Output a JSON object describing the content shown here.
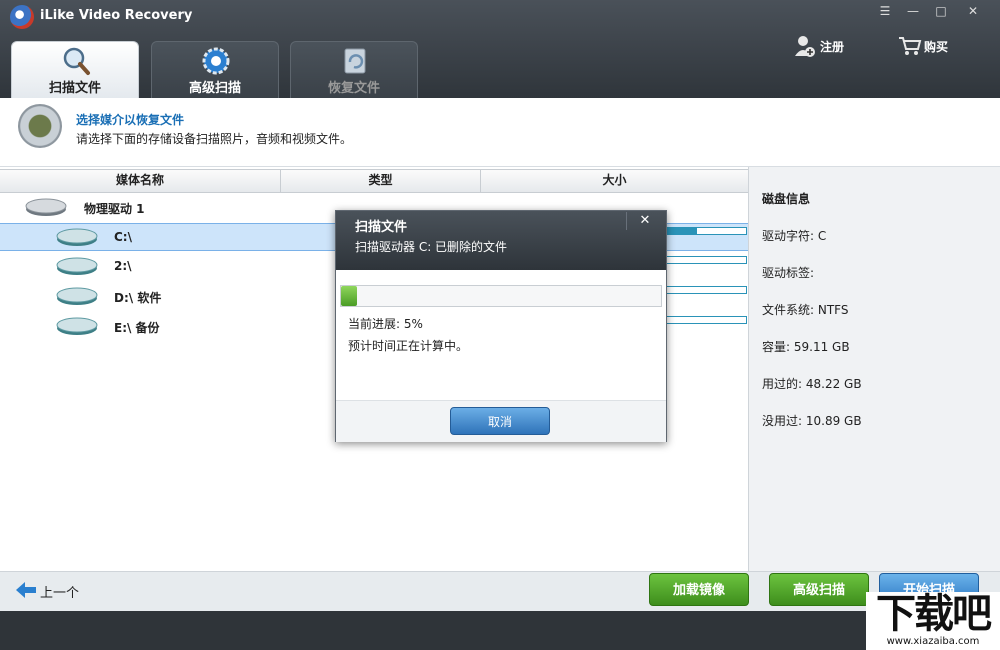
{
  "app": {
    "title": "iLike Video Recovery"
  },
  "window_controls": {
    "menu": "☰",
    "minimize": "—",
    "maximize": "□",
    "close": "✕"
  },
  "tabs": [
    {
      "label": "扫描文件",
      "state": "active"
    },
    {
      "label": "高级扫描",
      "state": "normal"
    },
    {
      "label": "恢复文件",
      "state": "disabled"
    }
  ],
  "top_actions": {
    "register": "注册",
    "buy": "购买"
  },
  "header": {
    "title": "选择媒介以恢复文件",
    "subtitle": "请选择下面的存储设备扫描照片，音频和视频文件。"
  },
  "table": {
    "columns": [
      "媒体名称",
      "类型",
      "大小"
    ],
    "group": "物理驱动 1",
    "drives": [
      {
        "label": "C:\\",
        "selected": true,
        "usage": 0.4
      },
      {
        "label": "2:\\",
        "selected": false,
        "usage": 0.0
      },
      {
        "label": "D:\\ 软件",
        "selected": false,
        "usage": 0.0
      },
      {
        "label": "E:\\ 备份",
        "selected": false,
        "usage": 0.0
      }
    ]
  },
  "disk_info": {
    "title": "磁盘信息",
    "drive_letter": "驱动字符:  C",
    "drive_label": "驱动标签:",
    "file_system": "文件系统:  NTFS",
    "capacity": "容量:  59.11 GB",
    "used": "用过的:  48.22 GB",
    "free": "没用过:  10.89 GB"
  },
  "bottom": {
    "back": "上一个",
    "load_image": "加载镜像",
    "advanced_scan": "高级扫描",
    "start_scan": "开始扫描"
  },
  "dialog": {
    "title": "扫描文件",
    "subtitle": "扫描驱动器 C: 已删除的文件",
    "close": "✕",
    "progress": 0.05,
    "current_progress": "当前进展:  5%",
    "eta": "预计时间正在计算中。",
    "cancel": "取消"
  },
  "watermark": {
    "text": "下载吧",
    "url": "www.xiazaiba.com"
  },
  "colors": {
    "accent_blue": "#1a6fb5",
    "green_button": "#4ea52a",
    "dark_bar": "#2f353b"
  }
}
